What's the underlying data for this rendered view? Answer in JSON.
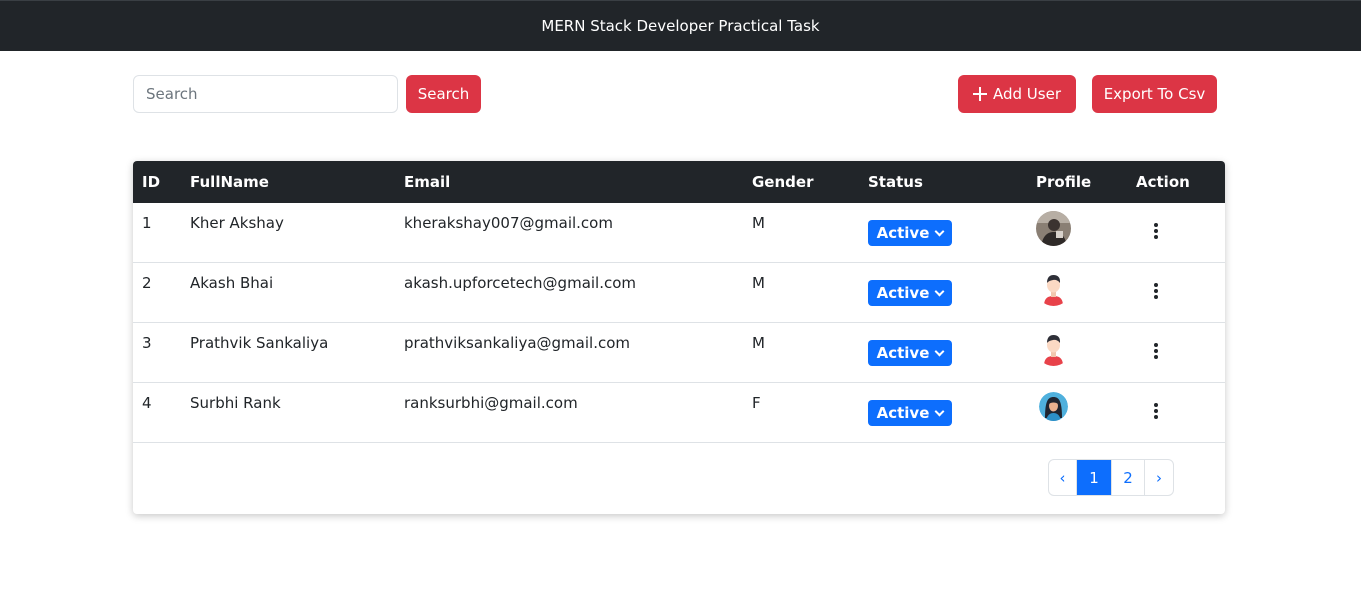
{
  "navbar": {
    "title": "MERN Stack Developer Practical Task"
  },
  "toolbar": {
    "search_placeholder": "Search",
    "search_value": "",
    "search_button": "Search",
    "add_user_button": "Add User",
    "export_button": "Export To Csv"
  },
  "table": {
    "headers": {
      "id": "ID",
      "fullname": "FullName",
      "email": "Email",
      "gender": "Gender",
      "status": "Status",
      "profile": "Profile",
      "action": "Action"
    },
    "rows": [
      {
        "id": "1",
        "fullname": "Kher Akshay",
        "email": "kherakshay007@gmail.com",
        "gender": "M",
        "status": "Active",
        "avatar": "photo-avatar"
      },
      {
        "id": "2",
        "fullname": "Akash Bhai",
        "email": "akash.upforcetech@gmail.com",
        "gender": "M",
        "status": "Active",
        "avatar": "male-avatar"
      },
      {
        "id": "3",
        "fullname": "Prathvik Sankaliya",
        "email": "prathviksankaliya@gmail.com",
        "gender": "M",
        "status": "Active",
        "avatar": "male-avatar"
      },
      {
        "id": "4",
        "fullname": "Surbhi Rank",
        "email": "ranksurbhi@gmail.com",
        "gender": "F",
        "status": "Active",
        "avatar": "female-avatar"
      }
    ]
  },
  "pagination": {
    "prev": "‹",
    "pages": [
      "1",
      "2"
    ],
    "next": "›",
    "current": "1"
  },
  "colors": {
    "navbar": "#212529",
    "danger": "#dc3545",
    "primary": "#0d6efd",
    "border": "#dee2e6"
  }
}
